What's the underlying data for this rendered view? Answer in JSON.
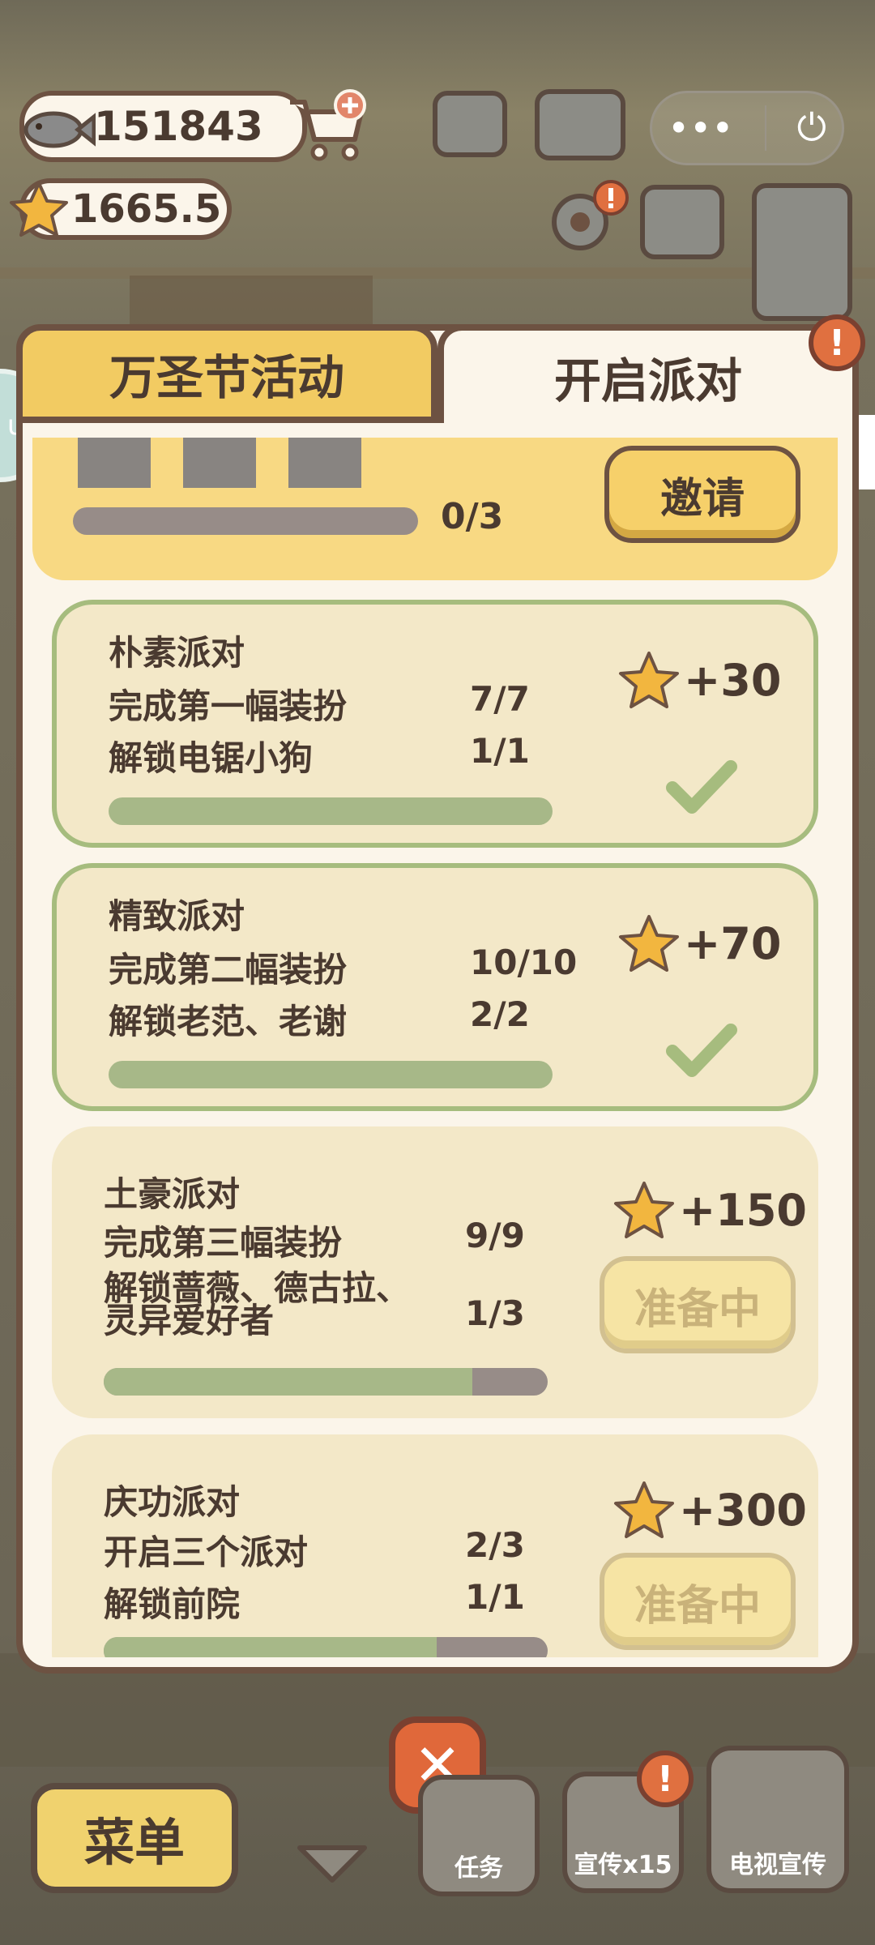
{
  "hud": {
    "fish_count": "151843",
    "star_count": "1665.5",
    "capsule_more": "•••",
    "capsule_power": "⏻"
  },
  "tabs": {
    "left": "万圣节活动",
    "right": "开启派对"
  },
  "invite": {
    "progress_text": "0/3",
    "progress_fraction": 0,
    "button_label": "邀请"
  },
  "side_bubble_text": "up",
  "cards": [
    {
      "title": "朴素派对",
      "lines": [
        {
          "label": "完成第一幅装扮",
          "value": "7/7"
        },
        {
          "label": "解锁电锯小狗",
          "value": "1/1"
        }
      ],
      "reward": "+30",
      "status": "done",
      "progress_fraction": 1.0
    },
    {
      "title": "精致派对",
      "lines": [
        {
          "label": "完成第二幅装扮",
          "value": "10/10"
        },
        {
          "label": "解锁老范、老谢",
          "value": "2/2"
        }
      ],
      "reward": "+70",
      "status": "done",
      "progress_fraction": 1.0
    },
    {
      "title": "土豪派对",
      "lines": [
        {
          "label": "完成第三幅装扮",
          "value": "9/9"
        },
        {
          "label": "解锁蔷薇、德古拉、",
          "value": ""
        },
        {
          "label": "灵异爱好者",
          "value": "1/3"
        }
      ],
      "reward": "+150",
      "status": "准备中",
      "progress_fraction": 0.83
    },
    {
      "title": "庆功派对",
      "lines": [
        {
          "label": "开启三个派对",
          "value": "2/3"
        },
        {
          "label": "解锁前院",
          "value": "1/1"
        }
      ],
      "reward": "+300",
      "status": "准备中",
      "progress_fraction": 0.75
    }
  ],
  "bottom": {
    "menu_label": "菜单",
    "task_label": "任务",
    "promo_label": "宣传x15",
    "tv_label": "电视宣传",
    "close_label": "✕"
  },
  "colors": {
    "panel_bg": "#fbf5ea",
    "border": "#6d5242",
    "gold": "#f2cb62",
    "green_fill": "#a7b888",
    "gray_track": "#978c88",
    "alert": "#e07040"
  }
}
